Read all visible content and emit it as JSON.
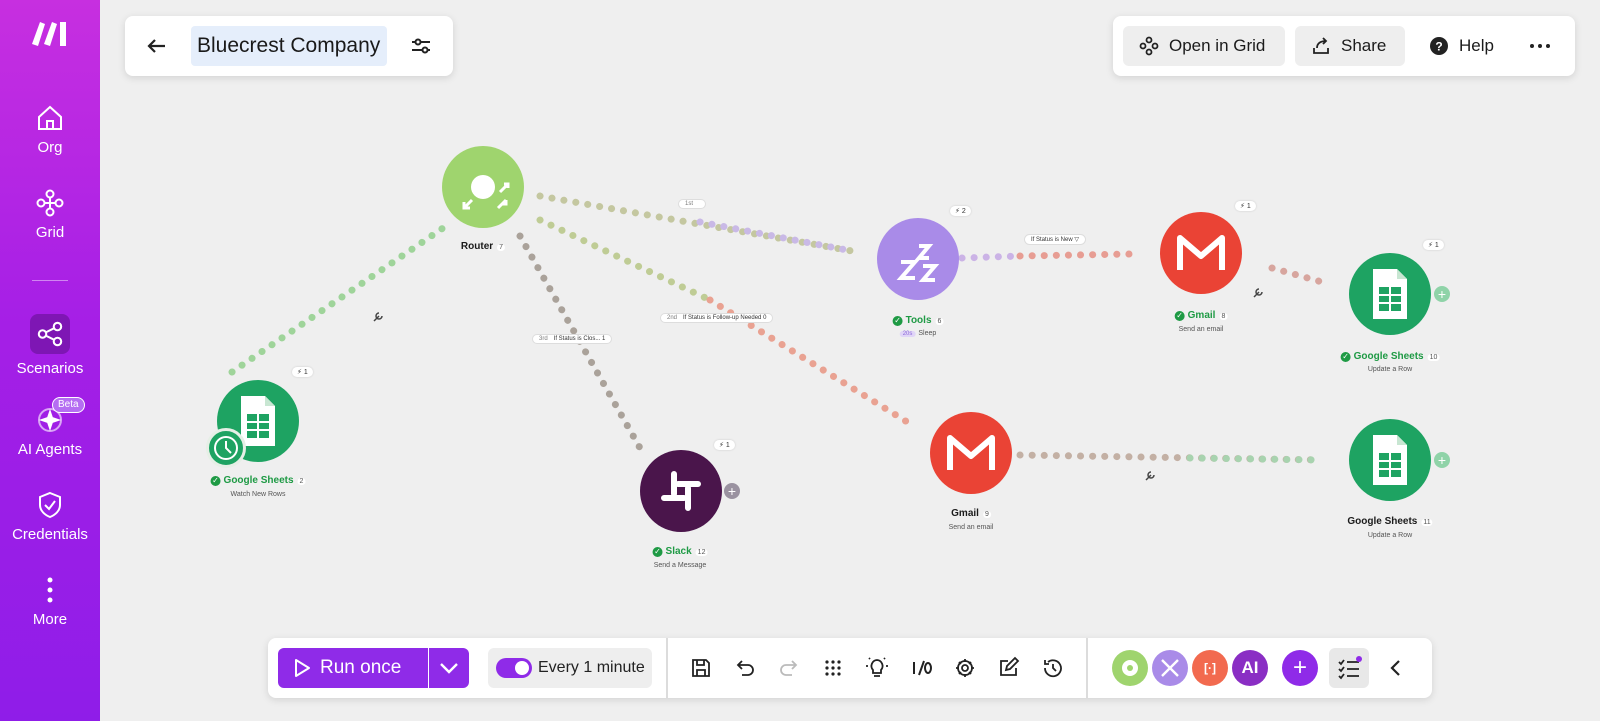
{
  "sidebar": {
    "items": [
      {
        "label": "Org",
        "icon": "home-icon"
      },
      {
        "label": "Grid",
        "icon": "grid-icon"
      },
      {
        "label": "Scenarios",
        "icon": "scenarios-icon"
      },
      {
        "label": "AI Agents",
        "icon": "ai-agents-icon",
        "badge": "Beta"
      },
      {
        "label": "Credentials",
        "icon": "shield-check-icon"
      },
      {
        "label": "More",
        "icon": "more-vertical-icon"
      }
    ]
  },
  "header": {
    "title": "Bluecrest Company"
  },
  "top_actions": {
    "open_in_grid": "Open in Grid",
    "share": "Share",
    "help": "Help"
  },
  "modules": {
    "router": {
      "name": "Router",
      "num": "7"
    },
    "sheets_watch": {
      "name": "Google Sheets",
      "num": "2",
      "action": "Watch New Rows",
      "ops": "1"
    },
    "slack": {
      "name": "Slack",
      "num": "12",
      "action": "Send a Message",
      "ops": "1"
    },
    "tools": {
      "name": "Tools",
      "num": "6",
      "action": "Sleep",
      "tag": "20s",
      "ops": "2"
    },
    "gmail_1": {
      "name": "Gmail",
      "num": "8",
      "action": "Send an email",
      "ops": "1"
    },
    "sheets_update_1": {
      "name": "Google Sheets",
      "num": "10",
      "action": "Update a Row",
      "ops": "1"
    },
    "gmail_2": {
      "name": "Gmail",
      "num": "9",
      "action": "Send an email"
    },
    "sheets_update_2": {
      "name": "Google Sheets",
      "num": "11",
      "action": "Update a Row"
    }
  },
  "routes": {
    "route_1": "1st",
    "route_2_order": "2nd",
    "route_2_label": "If Status is Follow-up Needed",
    "route_2_count": "0",
    "route_3_order": "3rd",
    "route_3_label": "If Status is Clos...",
    "route_3_count": "1",
    "filter_new": "If Status is New"
  },
  "toolbar": {
    "run_label": "Run once",
    "schedule_label": "Every 1 minute",
    "schedule_enabled": true
  },
  "colors": {
    "brand": "#8f2be8",
    "sheets": "#1ea362",
    "router": "#9fd46e",
    "tools": "#a98be8",
    "gmail": "#ea4335",
    "slack": "#4a154b"
  }
}
